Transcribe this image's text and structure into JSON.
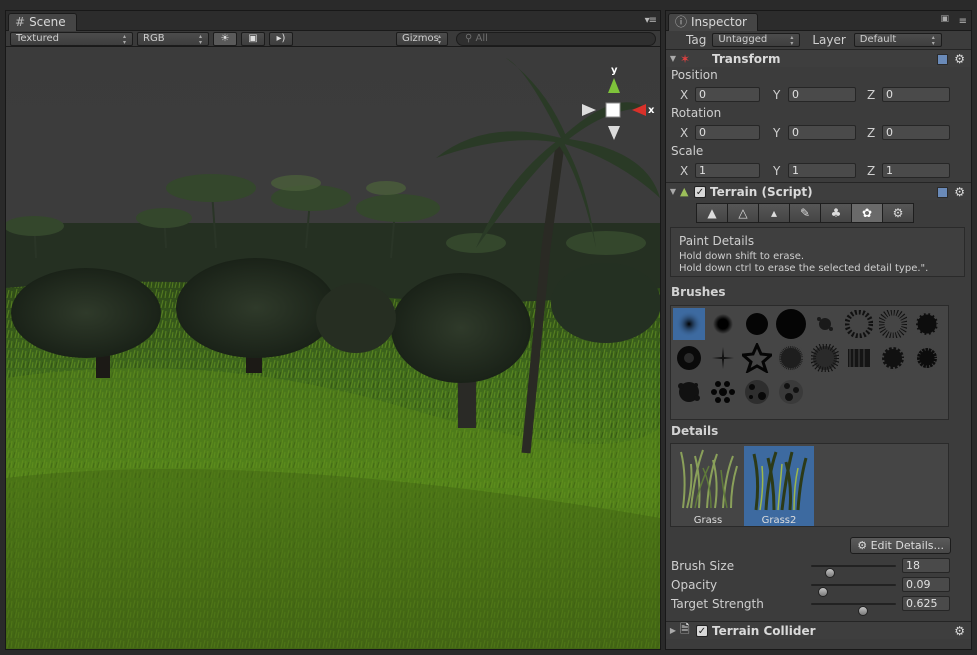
{
  "scene": {
    "tab_label": "Scene",
    "tab_icon": "grid-icon",
    "draw_mode": "Textured",
    "render_mode": "RGB",
    "gizmos_label": "Gizmos",
    "search_placeholder": "All",
    "axis_labels": {
      "y": "y",
      "x": "x"
    }
  },
  "inspector": {
    "tab_label": "Inspector",
    "tag_label": "Tag",
    "tag_value": "Untagged",
    "layer_label": "Layer",
    "layer_value": "Default",
    "transform": {
      "title": "Transform",
      "position_label": "Position",
      "rotation_label": "Rotation",
      "scale_label": "Scale",
      "x_label": "X",
      "y_label": "Y",
      "z_label": "Z",
      "position": [
        "0",
        "0",
        "0"
      ],
      "rotation": [
        "0",
        "0",
        "0"
      ],
      "scale": [
        "1",
        "1",
        "1"
      ]
    },
    "terrain": {
      "title": "Terrain (Script)",
      "enabled": true,
      "tools": [
        "raise-lower-icon",
        "paint-height-icon",
        "smooth-height-icon",
        "paint-texture-icon",
        "place-trees-icon",
        "paint-details-icon",
        "settings-icon"
      ],
      "active_tool": 5,
      "paint_title": "Paint Details",
      "paint_line1": "Hold down shift to erase.",
      "paint_line2": "Hold down ctrl to erase the selected detail type.\".",
      "brushes_label": "Brushes",
      "details_label": "Details",
      "details": [
        {
          "label": "Grass",
          "selected": false
        },
        {
          "label": "Grass2",
          "selected": true
        }
      ],
      "edit_details_label": "Edit Details...",
      "brush_size_label": "Brush Size",
      "brush_size_value": "18",
      "brush_size_level": 0.18,
      "opacity_label": "Opacity",
      "opacity_value": "0.09",
      "opacity_level": 0.09,
      "target_strength_label": "Target Strength",
      "target_strength_value": "0.625",
      "target_strength_level": 0.625
    },
    "collider": {
      "title": "Terrain Collider",
      "enabled": true
    }
  },
  "colors": {
    "selection": "#3d6aa0",
    "panel_bg": "#3c3c3c",
    "gizmo_y": "#7ec33a",
    "gizmo_x": "#d8312a"
  }
}
